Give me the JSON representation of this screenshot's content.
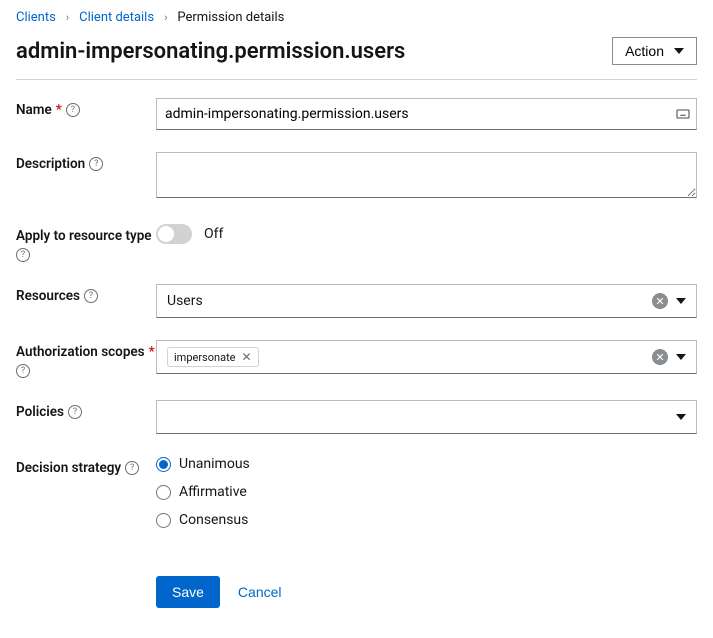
{
  "breadcrumb": {
    "clients": "Clients",
    "client_details": "Client details",
    "permission_details": "Permission details"
  },
  "title": "admin-impersonating.permission.users",
  "action_label": "Action",
  "fields": {
    "name": {
      "label": "Name",
      "value": "admin-impersonating.permission.users"
    },
    "description": {
      "label": "Description",
      "value": ""
    },
    "apply_to_resource_type": {
      "label": "Apply to resource type",
      "state_label": "Off",
      "on": false
    },
    "resources": {
      "label": "Resources",
      "value": "Users"
    },
    "authorization_scopes": {
      "label": "Authorization scopes",
      "chips": [
        "impersonate"
      ]
    },
    "policies": {
      "label": "Policies",
      "value": ""
    },
    "decision_strategy": {
      "label": "Decision strategy",
      "options": [
        "Unanimous",
        "Affirmative",
        "Consensus"
      ],
      "selected": "Unanimous"
    }
  },
  "buttons": {
    "save": "Save",
    "cancel": "Cancel"
  }
}
